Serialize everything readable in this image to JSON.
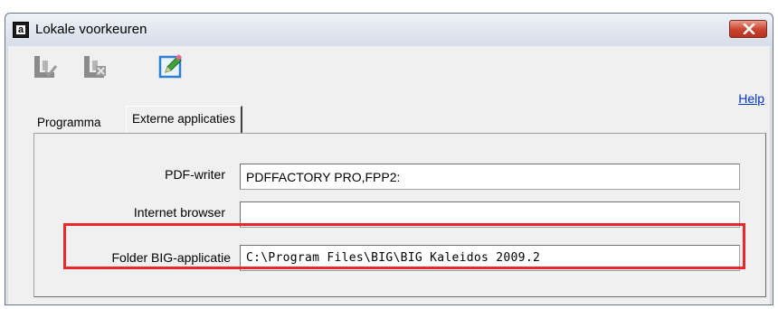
{
  "window": {
    "title": "Lokale voorkeuren",
    "app_icon_letter": "a"
  },
  "toolbar": {
    "save_icon": "save-check-icon",
    "cancel_icon": "save-cancel-icon",
    "edit_icon": "edit-pencil-icon",
    "help_label": "Help"
  },
  "tabs": [
    {
      "label": "Programma",
      "active": false
    },
    {
      "label": "Externe applicaties",
      "active": true
    }
  ],
  "fields": {
    "pdf_writer": {
      "label": "PDF-writer",
      "value": "PDFFACTORY PRO,FPP2:"
    },
    "internet_browser": {
      "label": "Internet browser",
      "value": ""
    },
    "folder_big": {
      "label": "Folder BIG-applicatie",
      "value": "C:\\Program Files\\BIG\\BIG Kaleidos 2009.2"
    }
  },
  "colors": {
    "highlight": "#e8282a",
    "link": "#0033cc",
    "close_button": "#c8432c"
  }
}
